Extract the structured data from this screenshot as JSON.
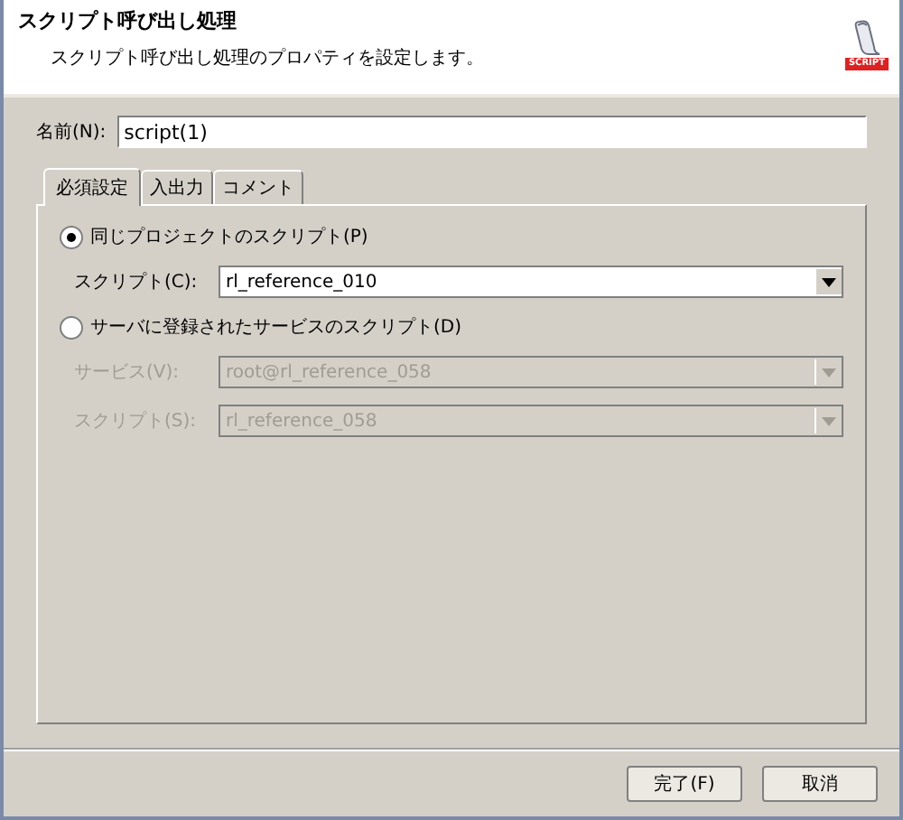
{
  "header": {
    "title": "スクリプト呼び出し処理",
    "description": "スクリプト呼び出し処理のプロパティを設定します。",
    "badge": "SCRIPT"
  },
  "name_field": {
    "label": "名前(N):",
    "value": "script(1)"
  },
  "tabs": [
    {
      "label": "必須設定",
      "selected": true
    },
    {
      "label": "入出力",
      "selected": false
    },
    {
      "label": "コメント",
      "selected": false
    }
  ],
  "options": [
    {
      "label": "同じプロジェクトのスクリプト(P)",
      "selected": true,
      "fields": [
        {
          "label": "スクリプト(C):",
          "value": "rl_reference_010",
          "disabled": false
        }
      ]
    },
    {
      "label": "サーバに登録されたサービスのスクリプト(D)",
      "selected": false,
      "fields": [
        {
          "label": "サービス(V):",
          "value": "root@rl_reference_058",
          "disabled": true
        },
        {
          "label": "スクリプト(S):",
          "value": "rl_reference_058",
          "disabled": true
        }
      ]
    }
  ],
  "buttons": [
    "完了(F)",
    "取消"
  ]
}
